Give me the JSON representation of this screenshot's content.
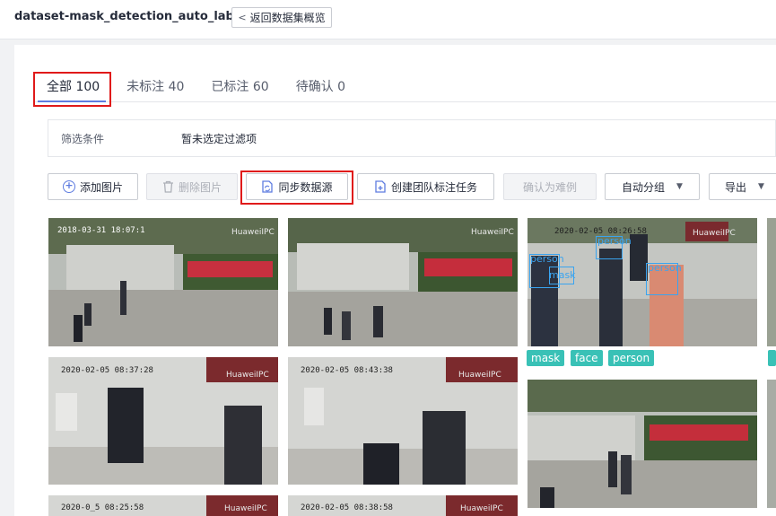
{
  "header": {
    "title": "dataset-mask_detection_auto_labeling",
    "back_label": "返回数据集概览"
  },
  "tabs": [
    {
      "label": "全部 100"
    },
    {
      "label": "未标注 40"
    },
    {
      "label": "已标注 60"
    },
    {
      "label": "待确认 0"
    }
  ],
  "filter": {
    "label": "筛选条件",
    "value": "暂未选定过滤项"
  },
  "toolbar": {
    "add": "添加图片",
    "delete": "删除图片",
    "sync": "同步数据源",
    "team": "创建团队标注任务",
    "hard": "确认为难例",
    "autogroup": "自动分组",
    "export": "导出"
  },
  "images": [
    {
      "timestamp": "2018-03-31 18:07:1",
      "watermark": "HuaweiIPC"
    },
    {
      "timestamp": "",
      "watermark": "HuaweiIPC"
    },
    {
      "timestamp": "2020-02-05 08:26:58",
      "watermark": "HuaweiIPC",
      "detections": [
        "person",
        "person",
        "person",
        "mask"
      ],
      "tags": [
        "mask",
        "face",
        "person"
      ]
    },
    {
      "timestamp": "2020-02-05 08:37:28",
      "watermark": "HuaweiIPC"
    },
    {
      "timestamp": "2020-02-05 08:43:38",
      "watermark": "HuaweiIPC"
    },
    {
      "timestamp": "",
      "watermark": ""
    },
    {
      "timestamp": "2020-0_5 08:25:58",
      "watermark": "HuaweiIPC"
    },
    {
      "timestamp": "2020-02-05 08:38:58",
      "watermark": "HuaweiIPC"
    }
  ],
  "colors": {
    "accent": "#5e7ce0",
    "tag": "#39c1b6",
    "highlight": "#e01a1a",
    "detection": "#3aa4f0"
  }
}
